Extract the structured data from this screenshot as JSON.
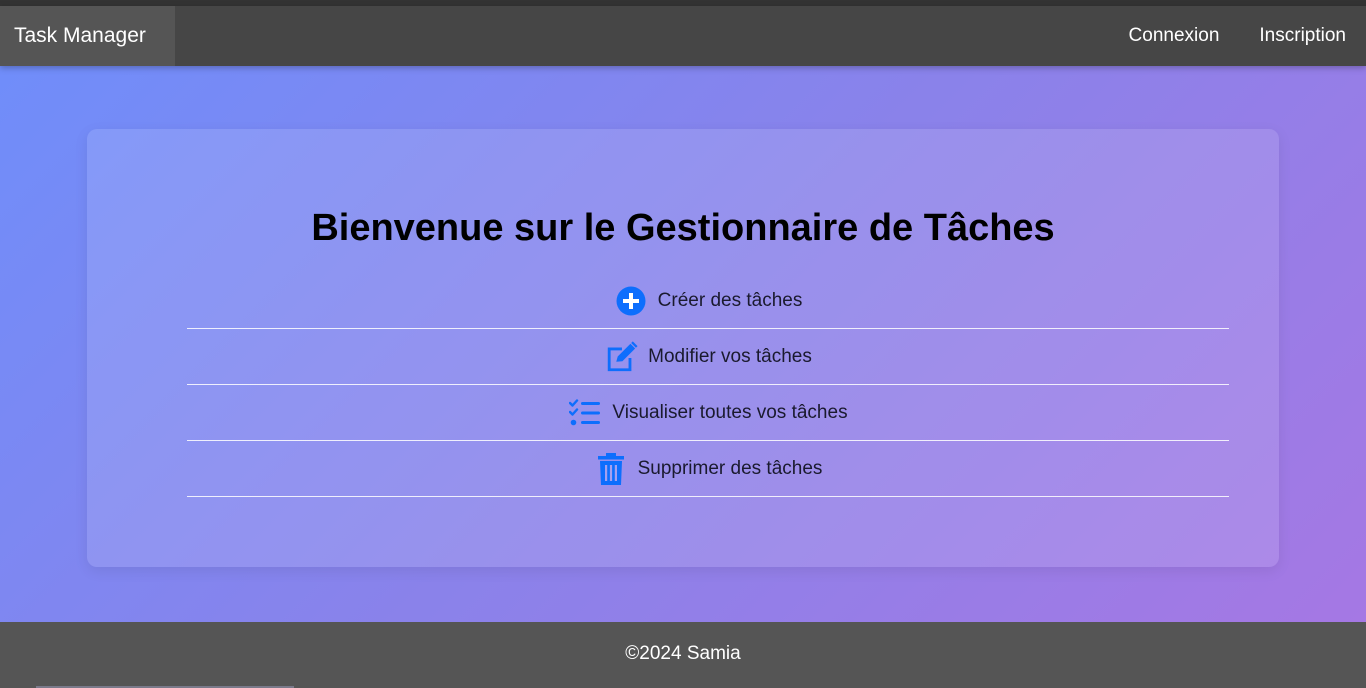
{
  "navbar": {
    "brand": "Task Manager",
    "links": [
      "Connexion",
      "Inscription"
    ]
  },
  "main": {
    "title": "Bienvenue sur le Gestionnaire de Tâches",
    "features": [
      {
        "label": "Créer des tâches",
        "icon": "plus-circle-icon"
      },
      {
        "label": "Modifier vos tâches",
        "icon": "edit-icon"
      },
      {
        "label": "Visualiser toutes vos tâches",
        "icon": "checklist-icon"
      },
      {
        "label": "Supprimer des tâches",
        "icon": "trash-icon"
      }
    ]
  },
  "footer": {
    "text": "©2024 Samia"
  },
  "colors": {
    "icon": "#0d6efd",
    "navbar": "#464646",
    "brand_bg": "#555555",
    "footer": "#555555",
    "gradient_start": "#6e8efb",
    "gradient_end": "#a777e3"
  }
}
